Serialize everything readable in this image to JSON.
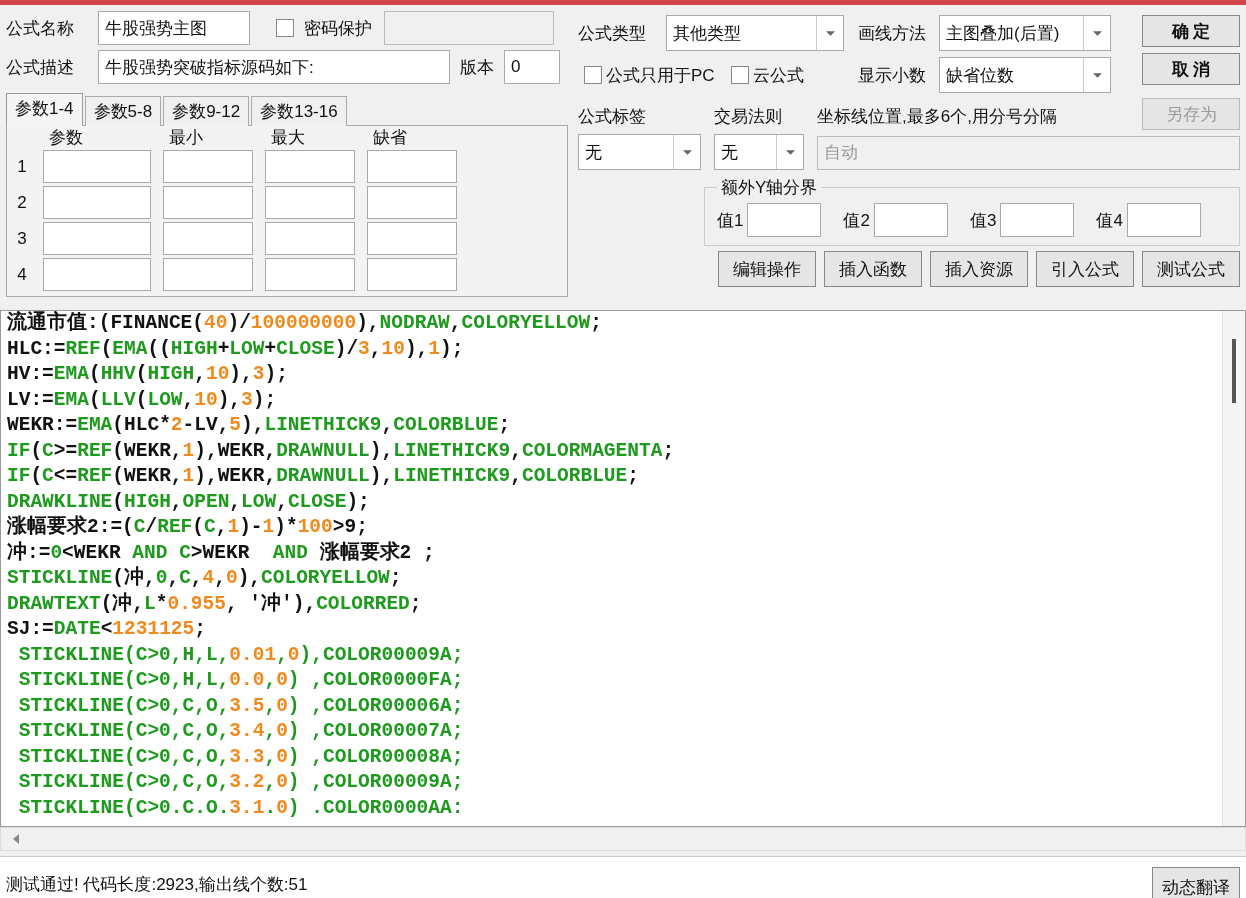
{
  "formula_name": {
    "label": "公式名称",
    "value": "牛股强势主图"
  },
  "password_protect": {
    "label": "密码保护",
    "checked": false
  },
  "password_field": {
    "disabled": true
  },
  "description": {
    "label": "公式描述",
    "value": "牛股强势突破指标源码如下:"
  },
  "version": {
    "label": "版本",
    "value": "0"
  },
  "param_tabs": [
    {
      "label": "参数1-4",
      "selected": true
    },
    {
      "label": "参数5-8",
      "selected": false
    },
    {
      "label": "参数9-12",
      "selected": false
    },
    {
      "label": "参数13-16",
      "selected": false
    }
  ],
  "param_table": {
    "columns": [
      "参数",
      "最小",
      "最大",
      "缺省"
    ],
    "rows": [
      "1",
      "2",
      "3",
      "4"
    ]
  },
  "formula_type": {
    "label": "公式类型",
    "value": "其他类型"
  },
  "draw_method": {
    "label": "画线方法",
    "value": "主图叠加(后置)"
  },
  "pc_only": {
    "label": "公式只用于PC",
    "checked": false
  },
  "cloud_formula": {
    "label": "云公式",
    "checked": false
  },
  "decimals": {
    "label": "显示小数",
    "value": "缺省位数"
  },
  "dialog_buttons": [
    {
      "label": "确 定",
      "disabled": false
    },
    {
      "label": "取 消",
      "disabled": false
    },
    {
      "label": "另存为",
      "disabled": true
    }
  ],
  "formula_tag": {
    "label": "公式标签",
    "value": "无"
  },
  "trade_rule": {
    "label": "交易法则",
    "value": "无"
  },
  "axis_lines": {
    "label": "坐标线位置,最多6个,用分号分隔",
    "placeholder": "自动",
    "disabled": true
  },
  "extra_y": {
    "title": "额外Y轴分界",
    "fields": [
      "值1",
      "值2",
      "值3",
      "值4"
    ]
  },
  "tool_buttons": [
    "编辑操作",
    "插入函数",
    "插入资源",
    "引入公式",
    "测试公式"
  ],
  "code_lines": [
    [
      {
        "kind": "plain",
        "text": "流通市值:(FINANCE("
      },
      {
        "kind": "number",
        "text": "40"
      },
      {
        "kind": "plain",
        "text": ")/"
      },
      {
        "kind": "number",
        "text": "100000000"
      },
      {
        "kind": "plain",
        "text": "),"
      },
      {
        "kind": "keyword",
        "text": "NODRAW"
      },
      {
        "kind": "plain",
        "text": ","
      },
      {
        "kind": "keyword",
        "text": "COLORYELLOW"
      },
      {
        "kind": "plain",
        "text": ";"
      }
    ],
    [
      {
        "kind": "plain",
        "text": "HLC:="
      },
      {
        "kind": "keyword",
        "text": "REF"
      },
      {
        "kind": "plain",
        "text": "("
      },
      {
        "kind": "keyword",
        "text": "EMA"
      },
      {
        "kind": "plain",
        "text": "(("
      },
      {
        "kind": "keyword",
        "text": "HIGH"
      },
      {
        "kind": "plain",
        "text": "+"
      },
      {
        "kind": "keyword",
        "text": "LOW"
      },
      {
        "kind": "plain",
        "text": "+"
      },
      {
        "kind": "keyword",
        "text": "CLOSE"
      },
      {
        "kind": "plain",
        "text": ")/"
      },
      {
        "kind": "number",
        "text": "3"
      },
      {
        "kind": "plain",
        "text": ","
      },
      {
        "kind": "number",
        "text": "10"
      },
      {
        "kind": "plain",
        "text": "),"
      },
      {
        "kind": "number",
        "text": "1"
      },
      {
        "kind": "plain",
        "text": ");"
      }
    ],
    [
      {
        "kind": "plain",
        "text": "HV:="
      },
      {
        "kind": "keyword",
        "text": "EMA"
      },
      {
        "kind": "plain",
        "text": "("
      },
      {
        "kind": "keyword",
        "text": "HHV"
      },
      {
        "kind": "plain",
        "text": "("
      },
      {
        "kind": "keyword",
        "text": "HIGH"
      },
      {
        "kind": "plain",
        "text": ","
      },
      {
        "kind": "number",
        "text": "10"
      },
      {
        "kind": "plain",
        "text": "),"
      },
      {
        "kind": "number",
        "text": "3"
      },
      {
        "kind": "plain",
        "text": ");"
      }
    ],
    [
      {
        "kind": "plain",
        "text": "LV:="
      },
      {
        "kind": "keyword",
        "text": "EMA"
      },
      {
        "kind": "plain",
        "text": "("
      },
      {
        "kind": "keyword",
        "text": "LLV"
      },
      {
        "kind": "plain",
        "text": "("
      },
      {
        "kind": "keyword",
        "text": "LOW"
      },
      {
        "kind": "plain",
        "text": ","
      },
      {
        "kind": "number",
        "text": "10"
      },
      {
        "kind": "plain",
        "text": "),"
      },
      {
        "kind": "number",
        "text": "3"
      },
      {
        "kind": "plain",
        "text": ");"
      }
    ],
    [
      {
        "kind": "plain",
        "text": "WEKR:="
      },
      {
        "kind": "keyword",
        "text": "EMA"
      },
      {
        "kind": "plain",
        "text": "(HLC*"
      },
      {
        "kind": "number",
        "text": "2"
      },
      {
        "kind": "plain",
        "text": "-LV,"
      },
      {
        "kind": "number",
        "text": "5"
      },
      {
        "kind": "plain",
        "text": "),"
      },
      {
        "kind": "keyword",
        "text": "LINETHICK9"
      },
      {
        "kind": "plain",
        "text": ","
      },
      {
        "kind": "keyword",
        "text": "COLORBLUE"
      },
      {
        "kind": "plain",
        "text": ";"
      }
    ],
    [
      {
        "kind": "keyword",
        "text": "IF"
      },
      {
        "kind": "plain",
        "text": "("
      },
      {
        "kind": "keyword",
        "text": "C"
      },
      {
        "kind": "plain",
        "text": ">="
      },
      {
        "kind": "keyword",
        "text": "REF"
      },
      {
        "kind": "plain",
        "text": "(WEKR,"
      },
      {
        "kind": "number",
        "text": "1"
      },
      {
        "kind": "plain",
        "text": "),WEKR,"
      },
      {
        "kind": "keyword",
        "text": "DRAWNULL"
      },
      {
        "kind": "plain",
        "text": "),"
      },
      {
        "kind": "keyword",
        "text": "LINETHICK9"
      },
      {
        "kind": "plain",
        "text": ","
      },
      {
        "kind": "keyword",
        "text": "COLORMAGENTA"
      },
      {
        "kind": "plain",
        "text": ";"
      }
    ],
    [
      {
        "kind": "keyword",
        "text": "IF"
      },
      {
        "kind": "plain",
        "text": "("
      },
      {
        "kind": "keyword",
        "text": "C"
      },
      {
        "kind": "plain",
        "text": "<="
      },
      {
        "kind": "keyword",
        "text": "REF"
      },
      {
        "kind": "plain",
        "text": "(WEKR,"
      },
      {
        "kind": "number",
        "text": "1"
      },
      {
        "kind": "plain",
        "text": "),WEKR,"
      },
      {
        "kind": "keyword",
        "text": "DRAWNULL"
      },
      {
        "kind": "plain",
        "text": "),"
      },
      {
        "kind": "keyword",
        "text": "LINETHICK9"
      },
      {
        "kind": "plain",
        "text": ","
      },
      {
        "kind": "keyword",
        "text": "COLORBLUE"
      },
      {
        "kind": "plain",
        "text": ";"
      }
    ],
    [
      {
        "kind": "keyword",
        "text": "DRAWKLINE"
      },
      {
        "kind": "plain",
        "text": "("
      },
      {
        "kind": "keyword",
        "text": "HIGH"
      },
      {
        "kind": "plain",
        "text": ","
      },
      {
        "kind": "keyword",
        "text": "OPEN"
      },
      {
        "kind": "plain",
        "text": ","
      },
      {
        "kind": "keyword",
        "text": "LOW"
      },
      {
        "kind": "plain",
        "text": ","
      },
      {
        "kind": "keyword",
        "text": "CLOSE"
      },
      {
        "kind": "plain",
        "text": ");"
      }
    ],
    [
      {
        "kind": "plain",
        "text": "涨幅要求2:=("
      },
      {
        "kind": "keyword",
        "text": "C"
      },
      {
        "kind": "plain",
        "text": "/"
      },
      {
        "kind": "keyword",
        "text": "REF"
      },
      {
        "kind": "plain",
        "text": "("
      },
      {
        "kind": "keyword",
        "text": "C"
      },
      {
        "kind": "plain",
        "text": ","
      },
      {
        "kind": "number",
        "text": "1"
      },
      {
        "kind": "plain",
        "text": ")-"
      },
      {
        "kind": "number",
        "text": "1"
      },
      {
        "kind": "plain",
        "text": ")*"
      },
      {
        "kind": "number",
        "text": "100"
      },
      {
        "kind": "plain",
        "text": ">9;"
      }
    ],
    [
      {
        "kind": "plain",
        "text": "冲:="
      },
      {
        "kind": "keyword",
        "text": "0"
      },
      {
        "kind": "plain",
        "text": "<WEKR "
      },
      {
        "kind": "keyword",
        "text": "AND "
      },
      {
        "kind": "keyword",
        "text": "C"
      },
      {
        "kind": "plain",
        "text": ">WEKR  "
      },
      {
        "kind": "keyword",
        "text": "AND"
      },
      {
        "kind": "plain",
        "text": " 涨幅要求2 ;"
      }
    ],
    [
      {
        "kind": "keyword",
        "text": "STICKLINE"
      },
      {
        "kind": "plain",
        "text": "(冲,"
      },
      {
        "kind": "keyword",
        "text": "0"
      },
      {
        "kind": "plain",
        "text": ","
      },
      {
        "kind": "keyword",
        "text": "C"
      },
      {
        "kind": "plain",
        "text": ","
      },
      {
        "kind": "number",
        "text": "4"
      },
      {
        "kind": "plain",
        "text": ","
      },
      {
        "kind": "number",
        "text": "0"
      },
      {
        "kind": "plain",
        "text": "),"
      },
      {
        "kind": "keyword",
        "text": "COLORYELLOW"
      },
      {
        "kind": "plain",
        "text": ";"
      }
    ],
    [
      {
        "kind": "keyword",
        "text": "DRAWTEXT"
      },
      {
        "kind": "plain",
        "text": "(冲,"
      },
      {
        "kind": "keyword",
        "text": "L"
      },
      {
        "kind": "plain",
        "text": "*"
      },
      {
        "kind": "number",
        "text": "0.955"
      },
      {
        "kind": "plain",
        "text": ", '冲'),"
      },
      {
        "kind": "keyword",
        "text": "COLORRED"
      },
      {
        "kind": "plain",
        "text": ";"
      }
    ],
    [
      {
        "kind": "plain",
        "text": "SJ:="
      },
      {
        "kind": "keyword",
        "text": "DATE"
      },
      {
        "kind": "plain",
        "text": "<"
      },
      {
        "kind": "number",
        "text": "1231125"
      },
      {
        "kind": "plain",
        "text": ";"
      }
    ],
    [
      {
        "kind": "keyword",
        "text": " STICKLINE(C>0,H,L,"
      },
      {
        "kind": "number",
        "text": "0.01"
      },
      {
        "kind": "keyword",
        "text": ","
      },
      {
        "kind": "number",
        "text": "0"
      },
      {
        "kind": "keyword",
        "text": "),COLOR00009A;"
      }
    ],
    [
      {
        "kind": "keyword",
        "text": " STICKLINE(C>0,H,L,"
      },
      {
        "kind": "number",
        "text": "0.0"
      },
      {
        "kind": "keyword",
        "text": ","
      },
      {
        "kind": "number",
        "text": "0"
      },
      {
        "kind": "keyword",
        "text": ") ,COLOR0000FA;"
      }
    ],
    [
      {
        "kind": "keyword",
        "text": " STICKLINE(C>0,C,O,"
      },
      {
        "kind": "number",
        "text": "3.5"
      },
      {
        "kind": "keyword",
        "text": ","
      },
      {
        "kind": "number",
        "text": "0"
      },
      {
        "kind": "keyword",
        "text": ") ,COLOR00006A;"
      }
    ],
    [
      {
        "kind": "keyword",
        "text": " STICKLINE(C>0,C,O,"
      },
      {
        "kind": "number",
        "text": "3.4"
      },
      {
        "kind": "keyword",
        "text": ","
      },
      {
        "kind": "number",
        "text": "0"
      },
      {
        "kind": "keyword",
        "text": ") ,COLOR00007A;"
      }
    ],
    [
      {
        "kind": "keyword",
        "text": " STICKLINE(C>0,C,O,"
      },
      {
        "kind": "number",
        "text": "3.3"
      },
      {
        "kind": "keyword",
        "text": ","
      },
      {
        "kind": "number",
        "text": "0"
      },
      {
        "kind": "keyword",
        "text": ") ,COLOR00008A;"
      }
    ],
    [
      {
        "kind": "keyword",
        "text": " STICKLINE(C>0,C,O,"
      },
      {
        "kind": "number",
        "text": "3.2"
      },
      {
        "kind": "keyword",
        "text": ","
      },
      {
        "kind": "number",
        "text": "0"
      },
      {
        "kind": "keyword",
        "text": ") ,COLOR00009A;"
      }
    ],
    [
      {
        "kind": "keyword",
        "text": " STICKLINE(C>0.C.O."
      },
      {
        "kind": "number",
        "text": "3.1"
      },
      {
        "kind": "keyword",
        "text": "."
      },
      {
        "kind": "number",
        "text": "0"
      },
      {
        "kind": "keyword",
        "text": ") .COLOR0000AA:"
      }
    ]
  ],
  "status": {
    "message": "测试通过! 代码长度:2923,输出线个数:51",
    "button": "动态翻译"
  }
}
